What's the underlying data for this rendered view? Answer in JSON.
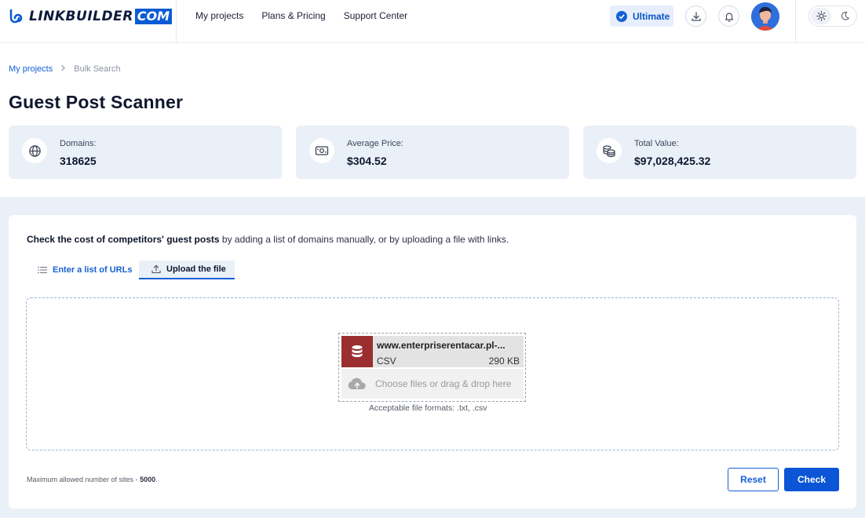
{
  "header": {
    "logo_word": "LINKBUILDER",
    "logo_suffix": "COM",
    "nav": [
      "My projects",
      "Plans & Pricing",
      "Support Center"
    ],
    "plan_badge": "Ultimate",
    "icons": [
      "download-icon",
      "bell-icon",
      "sun-icon",
      "moon-icon"
    ]
  },
  "breadcrumb": {
    "parent": "My projects",
    "current": "Bulk Search"
  },
  "page_title": "Guest Post Scanner",
  "stats": [
    {
      "label": "Domains:",
      "value": "318625",
      "icon": "globe-icon"
    },
    {
      "label": "Average Price:",
      "value": "$304.52",
      "icon": "money-icon"
    },
    {
      "label": "Total Value:",
      "value": "$97,028,425.32",
      "icon": "coins-icon"
    }
  ],
  "intro": {
    "bold": "Check the cost of competitors' guest posts",
    "rest": " by adding a list of domains manually, or by uploading a file with links."
  },
  "tabs": [
    {
      "label": "Enter a list of URLs",
      "active": false
    },
    {
      "label": "Upload the file",
      "active": true
    }
  ],
  "uploader": {
    "file_name": "www.enterpriserentacar.pl-...",
    "file_type": "CSV",
    "file_size": "290 KB",
    "choose_text": "Choose files or drag & drop here",
    "formats": "Acceptable file formats: .txt, .csv"
  },
  "limit": {
    "prefix": "Maximum allowed number of sites - ",
    "value": "5000",
    "suffix": "."
  },
  "buttons": {
    "reset": "Reset",
    "check": "Check"
  },
  "colors": {
    "accent": "#0b55d6",
    "card_bg": "#eaf0f8",
    "file_icon_bg": "#9b2e2e"
  }
}
